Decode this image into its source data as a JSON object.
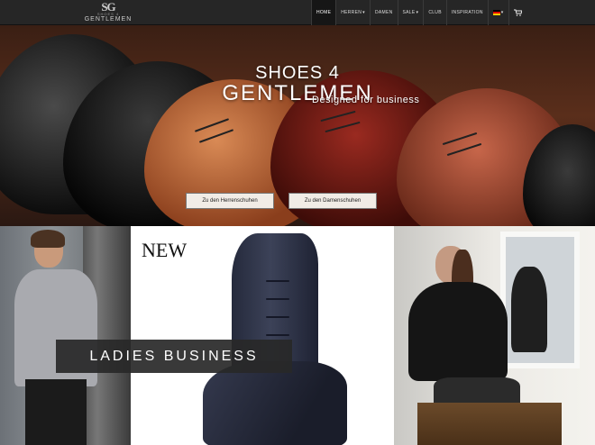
{
  "logo": {
    "mark": "SG",
    "small": "SHOES 4",
    "word": "GENTLEMEN"
  },
  "nav": {
    "items": [
      {
        "label": "HOME",
        "active": true
      },
      {
        "label": "HERREN",
        "dropdown": true
      },
      {
        "label": "DAMEN"
      },
      {
        "label": "SALE",
        "dropdown": true
      },
      {
        "label": "CLUB"
      },
      {
        "label": "INSPIRATION"
      }
    ],
    "language_icon": "de-flag-icon",
    "cart_icon": "cart-icon"
  },
  "hero": {
    "title_line1": "SHOES 4",
    "title_line2": "GENTLEMEN",
    "subtitle": "Designed for business",
    "cta_men": "Zu den Herrenschuhen",
    "cta_women": "Zu den Damenschuhen"
  },
  "promo": {
    "new_label": "NEW",
    "banner": "LADIES BUSINESS"
  }
}
